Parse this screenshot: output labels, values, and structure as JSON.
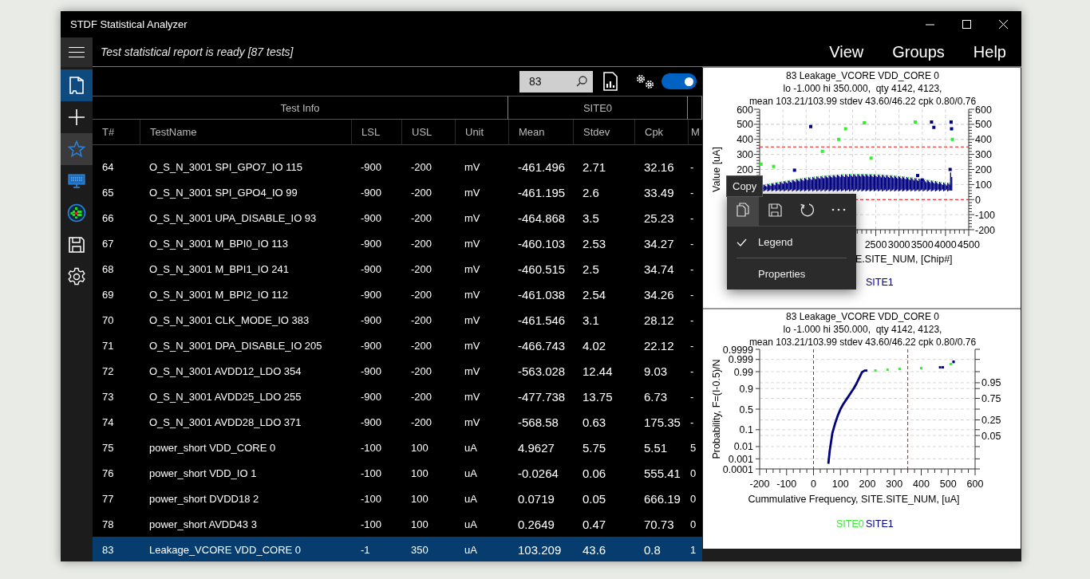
{
  "window": {
    "title": "STDF Statistical Analyzer"
  },
  "status": "Test statistical report is ready [87 tests]",
  "menu": [
    "View",
    "Groups",
    "Help"
  ],
  "nav": [
    {
      "kind": "report",
      "selected": true,
      "highlighted": false
    },
    {
      "kind": "add",
      "selected": false,
      "highlighted": false
    },
    {
      "kind": "favorites",
      "selected": false,
      "highlighted": true
    },
    {
      "kind": "monitor",
      "selected": false,
      "highlighted": false
    },
    {
      "kind": "wafer",
      "selected": false,
      "highlighted": false
    },
    {
      "kind": "save",
      "selected": false,
      "highlighted": false
    },
    {
      "kind": "settings",
      "selected": false,
      "highlighted": false
    }
  ],
  "toolbar": {
    "search": {
      "value": "83"
    },
    "toggle": {
      "on": true
    }
  },
  "table": {
    "column_groups": [
      {
        "label": "Test Info",
        "columns": [
          "T#",
          "TestName",
          "LSL",
          "USL",
          "Unit"
        ]
      },
      {
        "label": "SITE0",
        "columns": [
          "Mean",
          "Stdev",
          "Cpk"
        ]
      },
      {
        "columns": [
          "M"
        ]
      }
    ],
    "rows": [
      {
        "selected": false,
        "cells": [
          "64",
          "O_S_N_3001 SPI_GPO7_IO 115",
          "-900",
          "-200",
          "mV",
          "-461.496",
          "2.71",
          "32.16",
          "-"
        ]
      },
      {
        "selected": false,
        "cells": [
          "65",
          "O_S_N_3001 SPI_GPO4_IO 99",
          "-900",
          "-200",
          "mV",
          "-461.195",
          "2.6",
          "33.49",
          "-"
        ]
      },
      {
        "selected": false,
        "cells": [
          "66",
          "O_S_N_3001 UPA_DISABLE_IO 93",
          "-900",
          "-200",
          "mV",
          "-464.868",
          "3.5",
          "25.23",
          "-"
        ]
      },
      {
        "selected": false,
        "cells": [
          "67",
          "O_S_N_3001 M_BPI0_IO 113",
          "-900",
          "-200",
          "mV",
          "-460.103",
          "2.53",
          "34.27",
          "-"
        ]
      },
      {
        "selected": false,
        "cells": [
          "68",
          "O_S_N_3001 M_BPI1_IO 241",
          "-900",
          "-200",
          "mV",
          "-460.515",
          "2.5",
          "34.74",
          "-"
        ]
      },
      {
        "selected": false,
        "cells": [
          "69",
          "O_S_N_3001 M_BPI2_IO 112",
          "-900",
          "-200",
          "mV",
          "-461.038",
          "2.54",
          "34.26",
          "-"
        ]
      },
      {
        "selected": false,
        "cells": [
          "70",
          "O_S_N_3001 CLK_MODE_IO 383",
          "-900",
          "-200",
          "mV",
          "-461.546",
          "3.1",
          "28.12",
          "-"
        ]
      },
      {
        "selected": false,
        "cells": [
          "71",
          "O_S_N_3001 DPA_DISABLE_IO 205",
          "-900",
          "-200",
          "mV",
          "-466.743",
          "4.02",
          "22.12",
          "-"
        ]
      },
      {
        "selected": false,
        "cells": [
          "72",
          "O_S_N_3001 AVDD12_LDO 354",
          "-900",
          "-200",
          "mV",
          "-563.028",
          "12.44",
          "9.03",
          "-"
        ]
      },
      {
        "selected": false,
        "cells": [
          "73",
          "O_S_N_3001 AVDD25_LDO 255",
          "-900",
          "-200",
          "mV",
          "-477.738",
          "13.75",
          "6.73",
          "-"
        ]
      },
      {
        "selected": false,
        "cells": [
          "74",
          "O_S_N_3001 AVDD28_LDO 371",
          "-900",
          "-200",
          "mV",
          "-568.58",
          "0.63",
          "175.35",
          "-"
        ]
      },
      {
        "selected": false,
        "cells": [
          "75",
          "power_short VDD_CORE 0",
          "-100",
          "100",
          "uA",
          "4.9627",
          "5.75",
          "5.51",
          "5"
        ]
      },
      {
        "selected": false,
        "cells": [
          "76",
          "power_short VDD_IO 1",
          "-100",
          "100",
          "uA",
          "-0.0264",
          "0.06",
          "555.41",
          "0"
        ]
      },
      {
        "selected": false,
        "cells": [
          "77",
          "power_short DVDD18 2",
          "-100",
          "100",
          "uA",
          "0.0719",
          "0.05",
          "666.19",
          "0"
        ]
      },
      {
        "selected": false,
        "cells": [
          "78",
          "power_short AVDD43 3",
          "-100",
          "100",
          "uA",
          "0.2649",
          "0.47",
          "70.73",
          "0"
        ]
      },
      {
        "selected": true,
        "cells": [
          "83",
          "Leakage_VCORE VDD_CORE 0",
          "-1",
          "350",
          "uA",
          "103.209",
          "43.6",
          "0.8",
          "1"
        ]
      }
    ]
  },
  "charts": [
    {
      "chart_data": {
        "type": "scatter",
        "title": "83 Leakage_VCORE VDD_CORE 0\nlo -1.000 hi 350.000,  qty 4142, 4123,\nmean 103.21/103.99 stdev 43.60/46.22 cpk 0.80/0.76",
        "xlabel": "E.SITE_NUM, [Chip#]",
        "ylabel": "Value [uA]",
        "x": [
          30,
          300,
          750,
          1100,
          1350,
          1700,
          1850,
          2250,
          2400,
          3350,
          3400,
          3500,
          3700,
          3750,
          4100,
          4120,
          4130,
          4150
        ],
        "series": [
          {
            "color": "#33ee33",
            "values": [
              235,
              220,
              null,
              null,
              320,
              400,
              470,
              510,
              275,
              515,
              null,
              null,
              null,
              null,
              null,
              null,
              null,
              400
            ]
          },
          {
            "name": "SITE1",
            "color": "#000080",
            "values": [
              null,
              null,
              195,
              485,
              null,
              null,
              null,
              null,
              null,
              null,
              160,
              130,
              515,
              480,
              200,
              515,
              470,
              null
            ]
          }
        ],
        "xlim": [
          0,
          4500
        ],
        "ylim": [
          -200,
          600
        ],
        "xticks": [
          2500,
          3000,
          3500,
          4000,
          4500
        ],
        "yticks": [
          200,
          300,
          400,
          500,
          600
        ],
        "y2ticks": [
          -200,
          -100,
          0,
          100,
          200,
          300,
          400,
          500,
          600
        ],
        "y2lim": [
          -200,
          600
        ],
        "grid": true,
        "ref_lines": [
          {
            "axis": "y",
            "value": 350,
            "color": "#ff0000"
          },
          {
            "axis": "y",
            "value": 0,
            "color": "#ff0000"
          }
        ]
      }
    },
    {
      "title": "83 Leakage_VCORE VDD_CORE 0\nlo -1.000 hi 350.000,  qty 4142, 4123,\nmean 103.21/103.99 stdev 43.60/46.22 cpk 0.80/0.76",
      "x_axis_title": "Cummulative Frequency, SITE.SITE_NUM, [uA]",
      "y_axis_title": "Probability, F=(I-0.5)/N",
      "x_axis_labels": [
        "-200",
        "-100",
        "0",
        "100",
        "200",
        "300",
        "400",
        "500",
        "600"
      ],
      "y_axis_labels": [
        "0.9999",
        "0.999",
        "0.99",
        "0.9",
        "0.5",
        "0.1",
        "0.01",
        "0.001",
        "0.0001"
      ],
      "y2_axis_labels": [
        "0.95",
        "0.75",
        "0.25",
        "0.05"
      ],
      "legend": [
        {
          "name": "SITE0",
          "color": "#33ee33"
        },
        {
          "name": "SITE1",
          "color": "#000080"
        }
      ]
    }
  ],
  "chart_menu": {
    "tooltip": "Copy",
    "tools": [
      {
        "kind": "copy",
        "selected": true
      },
      {
        "kind": "save",
        "selected": false
      },
      {
        "kind": "refresh",
        "selected": false
      },
      {
        "kind": "more",
        "selected": false
      }
    ],
    "items": [
      {
        "label": "Legend",
        "checked": true
      },
      {
        "label": "Properties",
        "checked": false
      }
    ]
  }
}
